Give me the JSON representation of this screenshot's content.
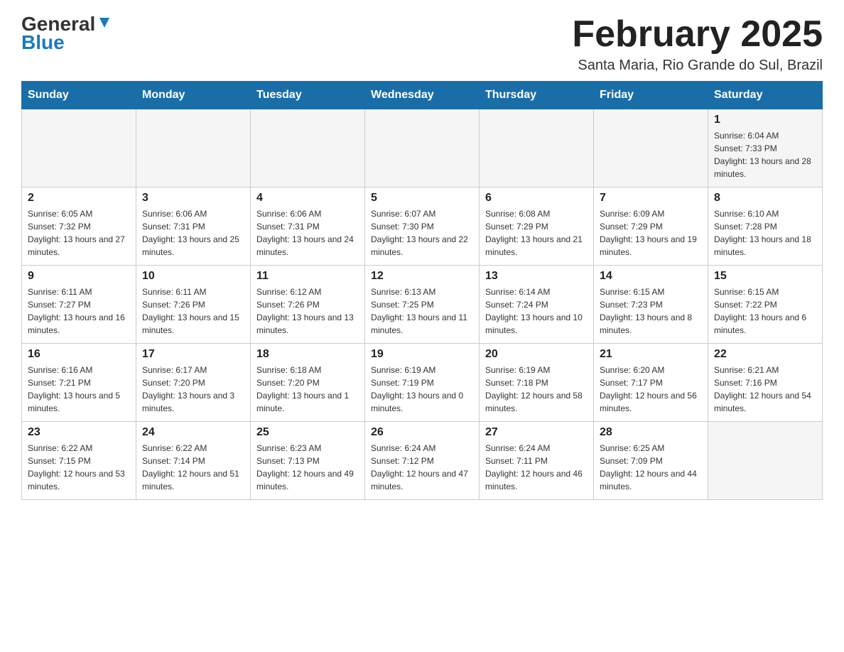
{
  "header": {
    "logo_general": "General",
    "logo_blue": "Blue",
    "main_title": "February 2025",
    "subtitle": "Santa Maria, Rio Grande do Sul, Brazil"
  },
  "days_of_week": [
    "Sunday",
    "Monday",
    "Tuesday",
    "Wednesday",
    "Thursday",
    "Friday",
    "Saturday"
  ],
  "weeks": [
    [
      {
        "day": "",
        "info": ""
      },
      {
        "day": "",
        "info": ""
      },
      {
        "day": "",
        "info": ""
      },
      {
        "day": "",
        "info": ""
      },
      {
        "day": "",
        "info": ""
      },
      {
        "day": "",
        "info": ""
      },
      {
        "day": "1",
        "info": "Sunrise: 6:04 AM\nSunset: 7:33 PM\nDaylight: 13 hours and 28 minutes."
      }
    ],
    [
      {
        "day": "2",
        "info": "Sunrise: 6:05 AM\nSunset: 7:32 PM\nDaylight: 13 hours and 27 minutes."
      },
      {
        "day": "3",
        "info": "Sunrise: 6:06 AM\nSunset: 7:31 PM\nDaylight: 13 hours and 25 minutes."
      },
      {
        "day": "4",
        "info": "Sunrise: 6:06 AM\nSunset: 7:31 PM\nDaylight: 13 hours and 24 minutes."
      },
      {
        "day": "5",
        "info": "Sunrise: 6:07 AM\nSunset: 7:30 PM\nDaylight: 13 hours and 22 minutes."
      },
      {
        "day": "6",
        "info": "Sunrise: 6:08 AM\nSunset: 7:29 PM\nDaylight: 13 hours and 21 minutes."
      },
      {
        "day": "7",
        "info": "Sunrise: 6:09 AM\nSunset: 7:29 PM\nDaylight: 13 hours and 19 minutes."
      },
      {
        "day": "8",
        "info": "Sunrise: 6:10 AM\nSunset: 7:28 PM\nDaylight: 13 hours and 18 minutes."
      }
    ],
    [
      {
        "day": "9",
        "info": "Sunrise: 6:11 AM\nSunset: 7:27 PM\nDaylight: 13 hours and 16 minutes."
      },
      {
        "day": "10",
        "info": "Sunrise: 6:11 AM\nSunset: 7:26 PM\nDaylight: 13 hours and 15 minutes."
      },
      {
        "day": "11",
        "info": "Sunrise: 6:12 AM\nSunset: 7:26 PM\nDaylight: 13 hours and 13 minutes."
      },
      {
        "day": "12",
        "info": "Sunrise: 6:13 AM\nSunset: 7:25 PM\nDaylight: 13 hours and 11 minutes."
      },
      {
        "day": "13",
        "info": "Sunrise: 6:14 AM\nSunset: 7:24 PM\nDaylight: 13 hours and 10 minutes."
      },
      {
        "day": "14",
        "info": "Sunrise: 6:15 AM\nSunset: 7:23 PM\nDaylight: 13 hours and 8 minutes."
      },
      {
        "day": "15",
        "info": "Sunrise: 6:15 AM\nSunset: 7:22 PM\nDaylight: 13 hours and 6 minutes."
      }
    ],
    [
      {
        "day": "16",
        "info": "Sunrise: 6:16 AM\nSunset: 7:21 PM\nDaylight: 13 hours and 5 minutes."
      },
      {
        "day": "17",
        "info": "Sunrise: 6:17 AM\nSunset: 7:20 PM\nDaylight: 13 hours and 3 minutes."
      },
      {
        "day": "18",
        "info": "Sunrise: 6:18 AM\nSunset: 7:20 PM\nDaylight: 13 hours and 1 minute."
      },
      {
        "day": "19",
        "info": "Sunrise: 6:19 AM\nSunset: 7:19 PM\nDaylight: 13 hours and 0 minutes."
      },
      {
        "day": "20",
        "info": "Sunrise: 6:19 AM\nSunset: 7:18 PM\nDaylight: 12 hours and 58 minutes."
      },
      {
        "day": "21",
        "info": "Sunrise: 6:20 AM\nSunset: 7:17 PM\nDaylight: 12 hours and 56 minutes."
      },
      {
        "day": "22",
        "info": "Sunrise: 6:21 AM\nSunset: 7:16 PM\nDaylight: 12 hours and 54 minutes."
      }
    ],
    [
      {
        "day": "23",
        "info": "Sunrise: 6:22 AM\nSunset: 7:15 PM\nDaylight: 12 hours and 53 minutes."
      },
      {
        "day": "24",
        "info": "Sunrise: 6:22 AM\nSunset: 7:14 PM\nDaylight: 12 hours and 51 minutes."
      },
      {
        "day": "25",
        "info": "Sunrise: 6:23 AM\nSunset: 7:13 PM\nDaylight: 12 hours and 49 minutes."
      },
      {
        "day": "26",
        "info": "Sunrise: 6:24 AM\nSunset: 7:12 PM\nDaylight: 12 hours and 47 minutes."
      },
      {
        "day": "27",
        "info": "Sunrise: 6:24 AM\nSunset: 7:11 PM\nDaylight: 12 hours and 46 minutes."
      },
      {
        "day": "28",
        "info": "Sunrise: 6:25 AM\nSunset: 7:09 PM\nDaylight: 12 hours and 44 minutes."
      },
      {
        "day": "",
        "info": ""
      }
    ]
  ]
}
